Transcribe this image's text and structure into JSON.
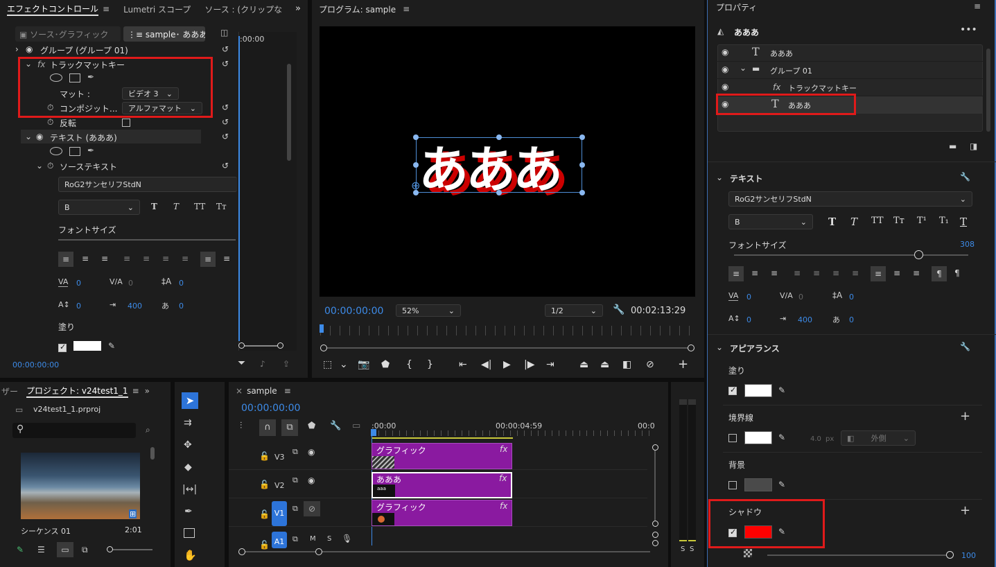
{
  "effect_controls": {
    "tabs": [
      "エフェクトコントロール",
      "Lumetri スコープ",
      "ソース : (クリップな"
    ],
    "src_tabs": [
      "ソース･グラフィック",
      "sample･ あああ"
    ],
    "timeline_time": ":00:00",
    "rows": {
      "group": "グループ (グループ 01)",
      "track_matte": "トラックマットキー",
      "matte_label": "マット :",
      "matte_value": "ビデオ 3",
      "composite_label": "コンポジット...",
      "composite_value": "アルファマット",
      "invert": "反転",
      "text_layer": "テキスト (あああ)",
      "source_text": "ソーステキスト",
      "font": "RoG2サンセリフStdN",
      "style": "B",
      "font_size": "フォントサイズ",
      "fill": "塗り"
    },
    "metrics": [
      "0",
      "0",
      "0",
      "0",
      "400",
      "0"
    ],
    "timecode": "00:00:00:00"
  },
  "program": {
    "title": "プログラム: sample",
    "canvas_text": "あああ",
    "timecode": "00:00:00:00",
    "zoom": "52%",
    "resolution": "1/2",
    "duration": "00:02:13:29"
  },
  "properties": {
    "title": "プロパティ",
    "layer_name": "あああ",
    "layers": [
      "あああ",
      "グループ 01",
      "トラックマットキー",
      "あああ"
    ],
    "text_section": "テキスト",
    "font": "RoG2サンセリフStdN",
    "style": "B",
    "font_size_label": "フォントサイズ",
    "font_size_value": "308",
    "metrics": [
      "0",
      "0",
      "0",
      "0",
      "400",
      "0"
    ],
    "appearance": "アピアランス",
    "fill": "塗り",
    "stroke": "境界線",
    "stroke_width": "4.0",
    "stroke_unit": "px",
    "stroke_pos": "外側",
    "background": "背景",
    "shadow": "シャドウ",
    "opacity": "100",
    "colors": {
      "fill": "#ffffff",
      "stroke": "#ffffff",
      "background": "#4a4a4a",
      "shadow": "#ff0000"
    }
  },
  "project": {
    "tab_prev": "ザー",
    "tab": "プロジェクト: v24test1_1",
    "file": "v24test1_1.prproj",
    "sequence": "シーケンス 01",
    "seq_duration": "2:01"
  },
  "timeline": {
    "tab": "sample",
    "timecode": "00:00:00:00",
    "ruler": [
      ":00:00",
      "00:00:04:59",
      "00:0"
    ],
    "tracks": [
      "V3",
      "V2",
      "V1",
      "A1"
    ],
    "clips": [
      "グラフィック",
      "あああ",
      "グラフィック"
    ],
    "clip_fx": "fx",
    "thumb_text": "aaa"
  },
  "meter": {
    "labels": [
      "S",
      "S"
    ]
  }
}
